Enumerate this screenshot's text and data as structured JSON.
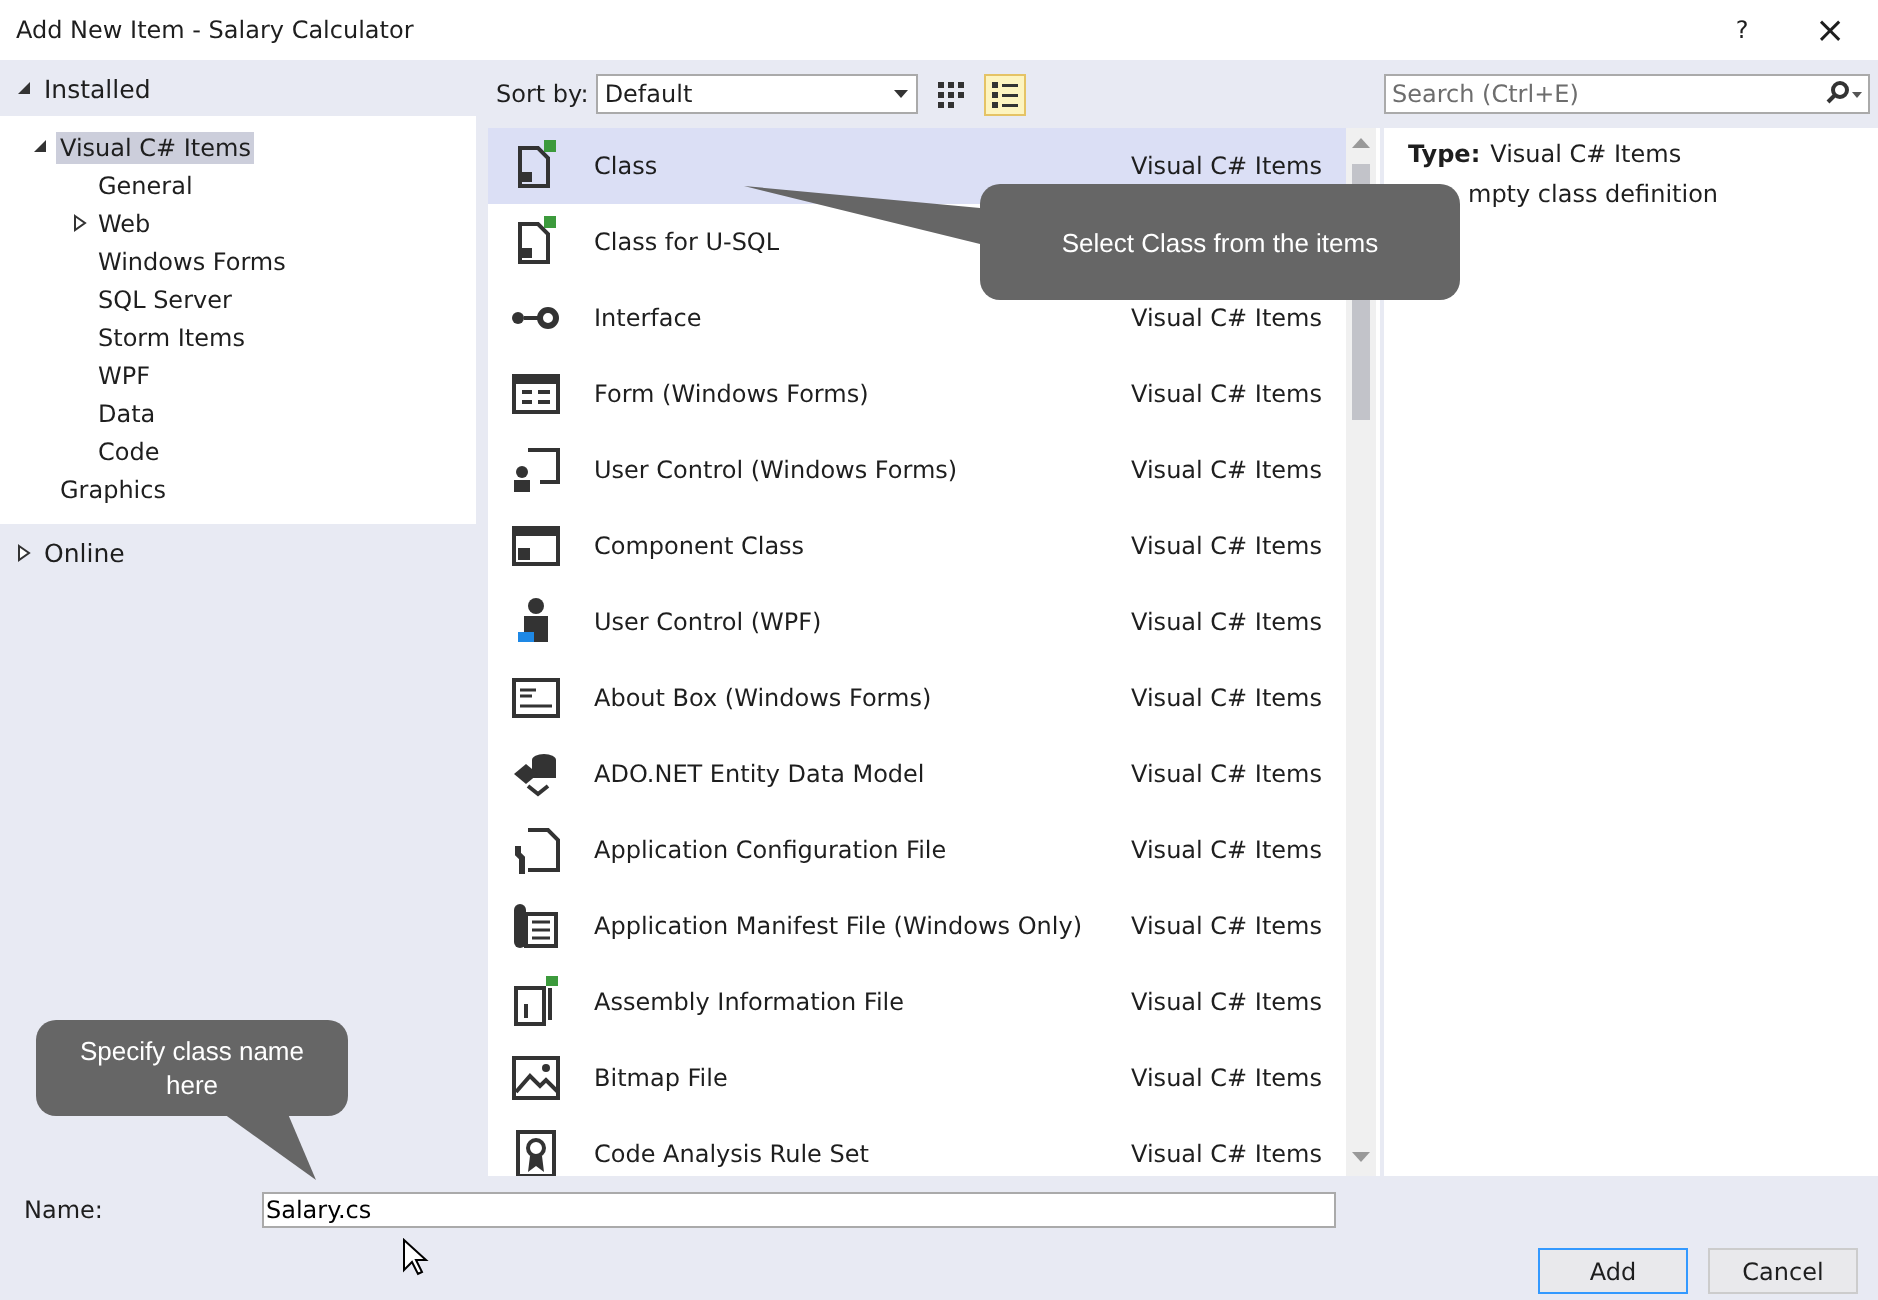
{
  "window": {
    "title": "Add New Item - Salary Calculator",
    "help": "?",
    "close": "×"
  },
  "sidebar": {
    "groups": [
      {
        "label": "Installed",
        "expanded": true,
        "children": [
          {
            "label": "Visual C# Items",
            "expanded": true,
            "selected": true,
            "children": [
              {
                "label": "General",
                "selected": false
              },
              {
                "label": "Web",
                "expanded": false,
                "selected": false
              },
              {
                "label": "Windows Forms",
                "selected": false
              },
              {
                "label": "SQL Server",
                "selected": false
              },
              {
                "label": "Storm Items",
                "selected": false
              },
              {
                "label": "WPF",
                "selected": false
              },
              {
                "label": "Data",
                "selected": false
              },
              {
                "label": "Code",
                "selected": false
              }
            ]
          },
          {
            "label": "Graphics",
            "selected": false
          }
        ]
      },
      {
        "label": "Online",
        "expanded": false
      }
    ]
  },
  "toolbar": {
    "sort_label": "Sort by:",
    "sort_value": "Default",
    "views": [
      {
        "kind": "grid",
        "selected": false
      },
      {
        "kind": "list",
        "selected": true
      }
    ],
    "search": {
      "placeholder": "Search (Ctrl+E)"
    }
  },
  "templates": [
    {
      "name": "Class",
      "category": "Visual C# Items",
      "selected": true
    },
    {
      "name": "Class for U-SQL",
      "selected": false
    },
    {
      "name": "Interface",
      "category": "Visual C# Items",
      "selected": false
    },
    {
      "name": "Form (Windows Forms)",
      "category": "Visual C# Items",
      "selected": false
    },
    {
      "name": "User Control (Windows Forms)",
      "category": "Visual C# Items",
      "selected": false
    },
    {
      "name": "Component Class",
      "category": "Visual C# Items",
      "selected": false
    },
    {
      "name": "User Control (WPF)",
      "category": "Visual C# Items",
      "selected": false
    },
    {
      "name": "About Box (Windows Forms)",
      "category": "Visual C# Items",
      "selected": false
    },
    {
      "name": "ADO.NET Entity Data Model",
      "category": "Visual C# Items",
      "selected": false
    },
    {
      "name": "Application Configuration File",
      "category": "Visual C# Items",
      "selected": false
    },
    {
      "name": "Application Manifest File (Windows Only)",
      "category": "Visual C# Items",
      "selected": false
    },
    {
      "name": "Assembly Information File",
      "category": "Visual C# Items",
      "selected": false
    },
    {
      "name": "Bitmap File",
      "category": "Visual C# Items",
      "selected": false
    },
    {
      "name": "Code Analysis Rule Set",
      "category": "Visual C# Items",
      "selected": false
    }
  ],
  "details": {
    "type_label": "Type:",
    "type_value": "Visual C# Items",
    "description": "mpty class definition"
  },
  "name_field": {
    "label": "Name:",
    "value": "Salary.cs"
  },
  "buttons": [
    {
      "label": "Add",
      "kind": "primary"
    },
    {
      "label": "Cancel",
      "kind": "normal"
    }
  ],
  "callouts": [
    {
      "text": "Select Class from the items",
      "kind": "list"
    },
    {
      "text": "Specify class name here",
      "kind": "name"
    }
  ]
}
